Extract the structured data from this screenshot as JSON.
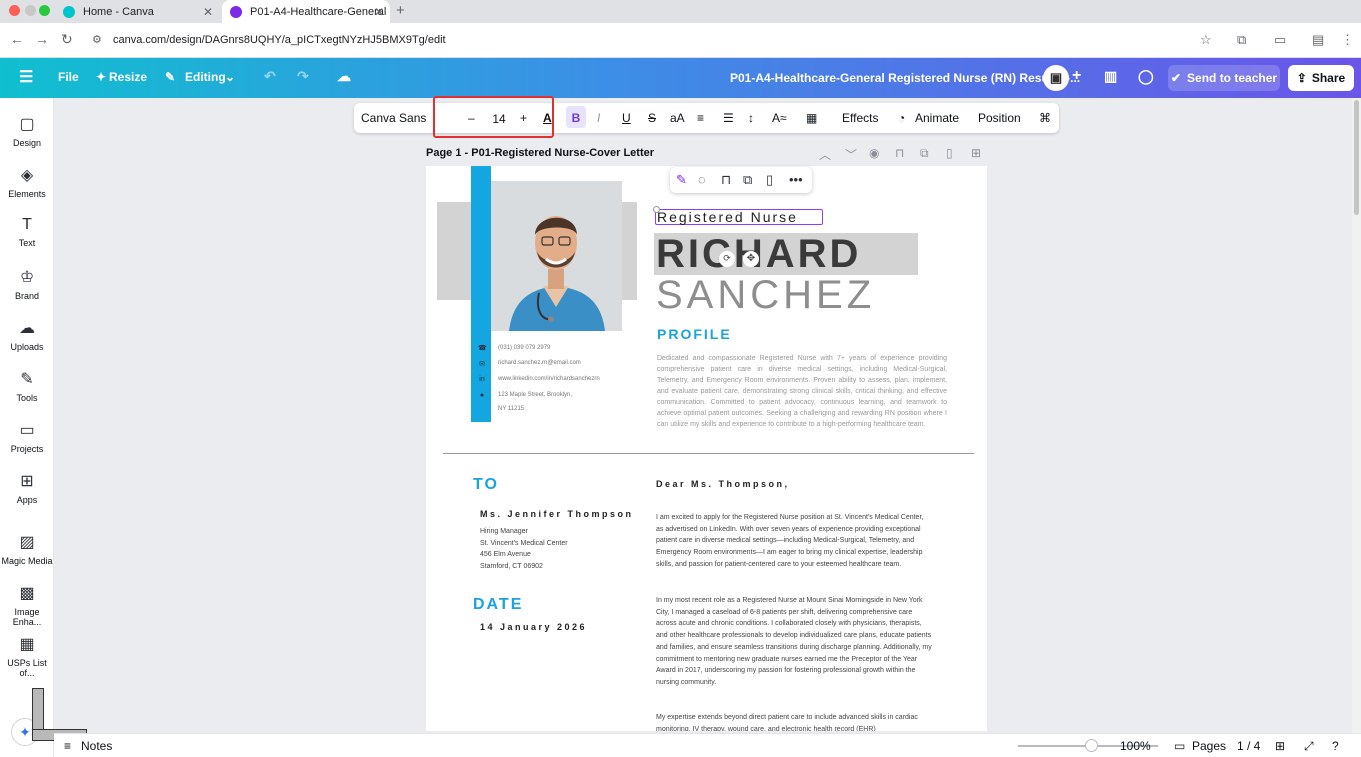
{
  "browser": {
    "tabs": [
      {
        "label": "Home - Canva"
      },
      {
        "label": "P01-A4-Healthcare-General"
      }
    ],
    "url": "canva.com/design/DAGnrs8UQHY/a_pICTxegtNYzHJ5BMX9Tg/edit"
  },
  "header": {
    "file_label": "File",
    "resize_label": "Resize",
    "editing_label": "Editing",
    "title": "P01-A4-Healthcare-General Registered Nurse (RN) Resume-...",
    "send_label": "Send to teacher",
    "share_label": "Share"
  },
  "sidebar": {
    "items": [
      {
        "label": "Design",
        "icon": "design-icon"
      },
      {
        "label": "Elements",
        "icon": "elements-icon"
      },
      {
        "label": "Text",
        "icon": "text-icon"
      },
      {
        "label": "Brand",
        "icon": "brand-icon"
      },
      {
        "label": "Uploads",
        "icon": "uploads-icon"
      },
      {
        "label": "Tools",
        "icon": "tools-icon"
      },
      {
        "label": "Projects",
        "icon": "projects-icon"
      },
      {
        "label": "Apps",
        "icon": "apps-icon"
      },
      {
        "label": "Magic Media",
        "icon": "magic-media-icon"
      },
      {
        "label": "Image Enha...",
        "icon": "image-enhancer-icon"
      },
      {
        "label": "USPs List of...",
        "icon": "usps-list-icon"
      }
    ]
  },
  "toolbar": {
    "font_name": "Canva Sans",
    "font_size": "14",
    "minus": "–",
    "plus": "+",
    "effects_label": "Effects",
    "animate_label": "Animate",
    "position_label": "Position"
  },
  "page": {
    "title": "Page 1 - P01-Registered Nurse-Cover Letter"
  },
  "document": {
    "role": "Registered Nurse",
    "first_name": "RICHARD",
    "last_name": "SANCHEZ",
    "contact": {
      "phone": "(031) 039 079 2979",
      "email": "richard.sanchez.rn@email.com",
      "linkedin": "www.linkedin.com/in/richardsanchezrn",
      "address1": "123 Maple Street, Brooklyn,",
      "address2": "NY 11215"
    },
    "profile_heading": "PROFILE",
    "profile_text": "Dedicated and compassionate Registered Nurse with 7+ years of experience providing comprehensive patient care in diverse medical settings, including Medical-Surgical, Telemetry, and Emergency Room environments. Proven ability to assess, plan, implement, and evaluate patient care, demonstrating strong clinical skills, critical thinking, and effective communication. Committed to patient advocacy, continuous learning, and teamwork to achieve optimal patient outcomes. Seeking a challenging and rewarding RN position where I can utilize my skills and experience to contribute to a high-performing healthcare team.",
    "to_heading": "TO",
    "recipient_name": "Ms. Jennifer Thompson",
    "recipient_title": "Hiring Manager",
    "recipient_org": "St. Vincent's Medical Center",
    "recipient_street": "456 Elm Avenue",
    "recipient_city": "Stamford, CT 06902",
    "date_heading": "DATE",
    "date_value": "14 January 2026",
    "salutation": "Dear Ms. Thompson,",
    "para1": "I am excited to apply for the Registered Nurse position at St. Vincent's Medical Center, as advertised on LinkedIn. With over seven years of experience providing exceptional patient care in diverse medical settings—including Medical-Surgical, Telemetry, and Emergency Room environments—I am eager to bring my clinical expertise, leadership skills, and passion for patient-centered care to your esteemed healthcare team.",
    "para2": "In my most recent role as a Registered Nurse at Mount Sinai Morningside in New York City, I managed a caseload of 6-8 patients per shift, delivering comprehensive care across acute and chronic conditions. I collaborated closely with physicians, therapists, and other healthcare professionals to develop individualized care plans, educate patients and families, and ensure seamless transitions during discharge planning. Additionally, my commitment to mentoring new graduate nurses earned me the Preceptor of the Year Award in 2017, underscoring my passion for fostering professional growth within the nursing community.",
    "para3": "My expertise extends beyond direct patient care to include advanced skills in cardiac monitoring, IV therapy, wound care, and electronic health record (EHR)"
  },
  "bottombar": {
    "notes_label": "Notes",
    "zoom": "100%",
    "pages_label": "Pages",
    "page_count": "1 / 4",
    "zoom_fraction": 0.52
  },
  "colors": {
    "accent_blue": "#14a6e1",
    "selection_purple": "#8b3dff",
    "highlight_red": "#e03131"
  }
}
